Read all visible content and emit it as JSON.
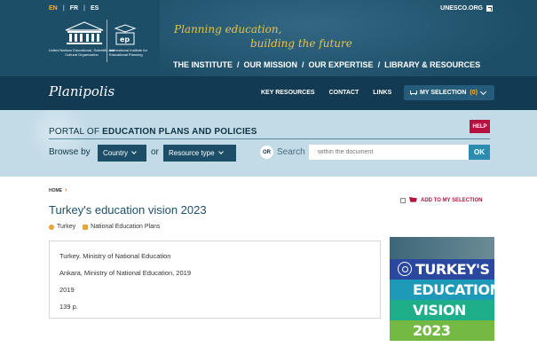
{
  "header": {
    "languages": [
      "EN",
      "FR",
      "ES"
    ],
    "active_language": "EN",
    "unesco_link": "UNESCO.ORG",
    "unesco_logo_text": "UNESCO",
    "unesco_caption": "United Nations Educational, Scientific and Cultural Organization",
    "iiep_caption": "International Institute for Educational Planning",
    "slogan_line1": "Planning education,",
    "slogan_line2": "building the future",
    "nav": [
      "THE INSTITUTE",
      "OUR MISSION",
      "OUR EXPERTISE",
      "LIBRARY & RESOURCES"
    ]
  },
  "band": {
    "logo": "Planipolis",
    "links": [
      "KEY RESOURCES",
      "CONTACT",
      "LINKS"
    ],
    "my_selection_label": "MY SELECTION",
    "my_selection_count": "(0)"
  },
  "portal": {
    "title_prefix": "PORTAL OF ",
    "title_bold": "EDUCATION PLANS AND POLICIES",
    "help": "HELP",
    "browse_label": "Browse by",
    "country_dropdown": "Country",
    "or_text": "or",
    "resource_dropdown": "Resource type",
    "or_badge": "OR",
    "search_label": "Search",
    "search_placeholder": "within the document",
    "ok": "OK"
  },
  "content": {
    "breadcrumb": "HOME",
    "add_to_selection": "ADD TO MY SELECTION",
    "title": "Turkey's education vision 2023",
    "tags": [
      {
        "label": "Turkey",
        "icon": "globe-icon"
      },
      {
        "label": "National Education Plans",
        "icon": "folder-icon"
      }
    ],
    "info": [
      "Turkey. Ministry of National Education",
      "Ankara, Ministry of National Education, 2019",
      "2019",
      "139 p."
    ],
    "cover_lines": [
      "TURKEY'S",
      "EDUCATION",
      "VISION",
      "2023"
    ]
  },
  "colors": {
    "header_bg": "#1d4e68",
    "band_bg": "#123a52",
    "portal_bg": "#c2dbe7",
    "accent_red": "#b5123f",
    "accent_yellow": "#e8c24a"
  }
}
